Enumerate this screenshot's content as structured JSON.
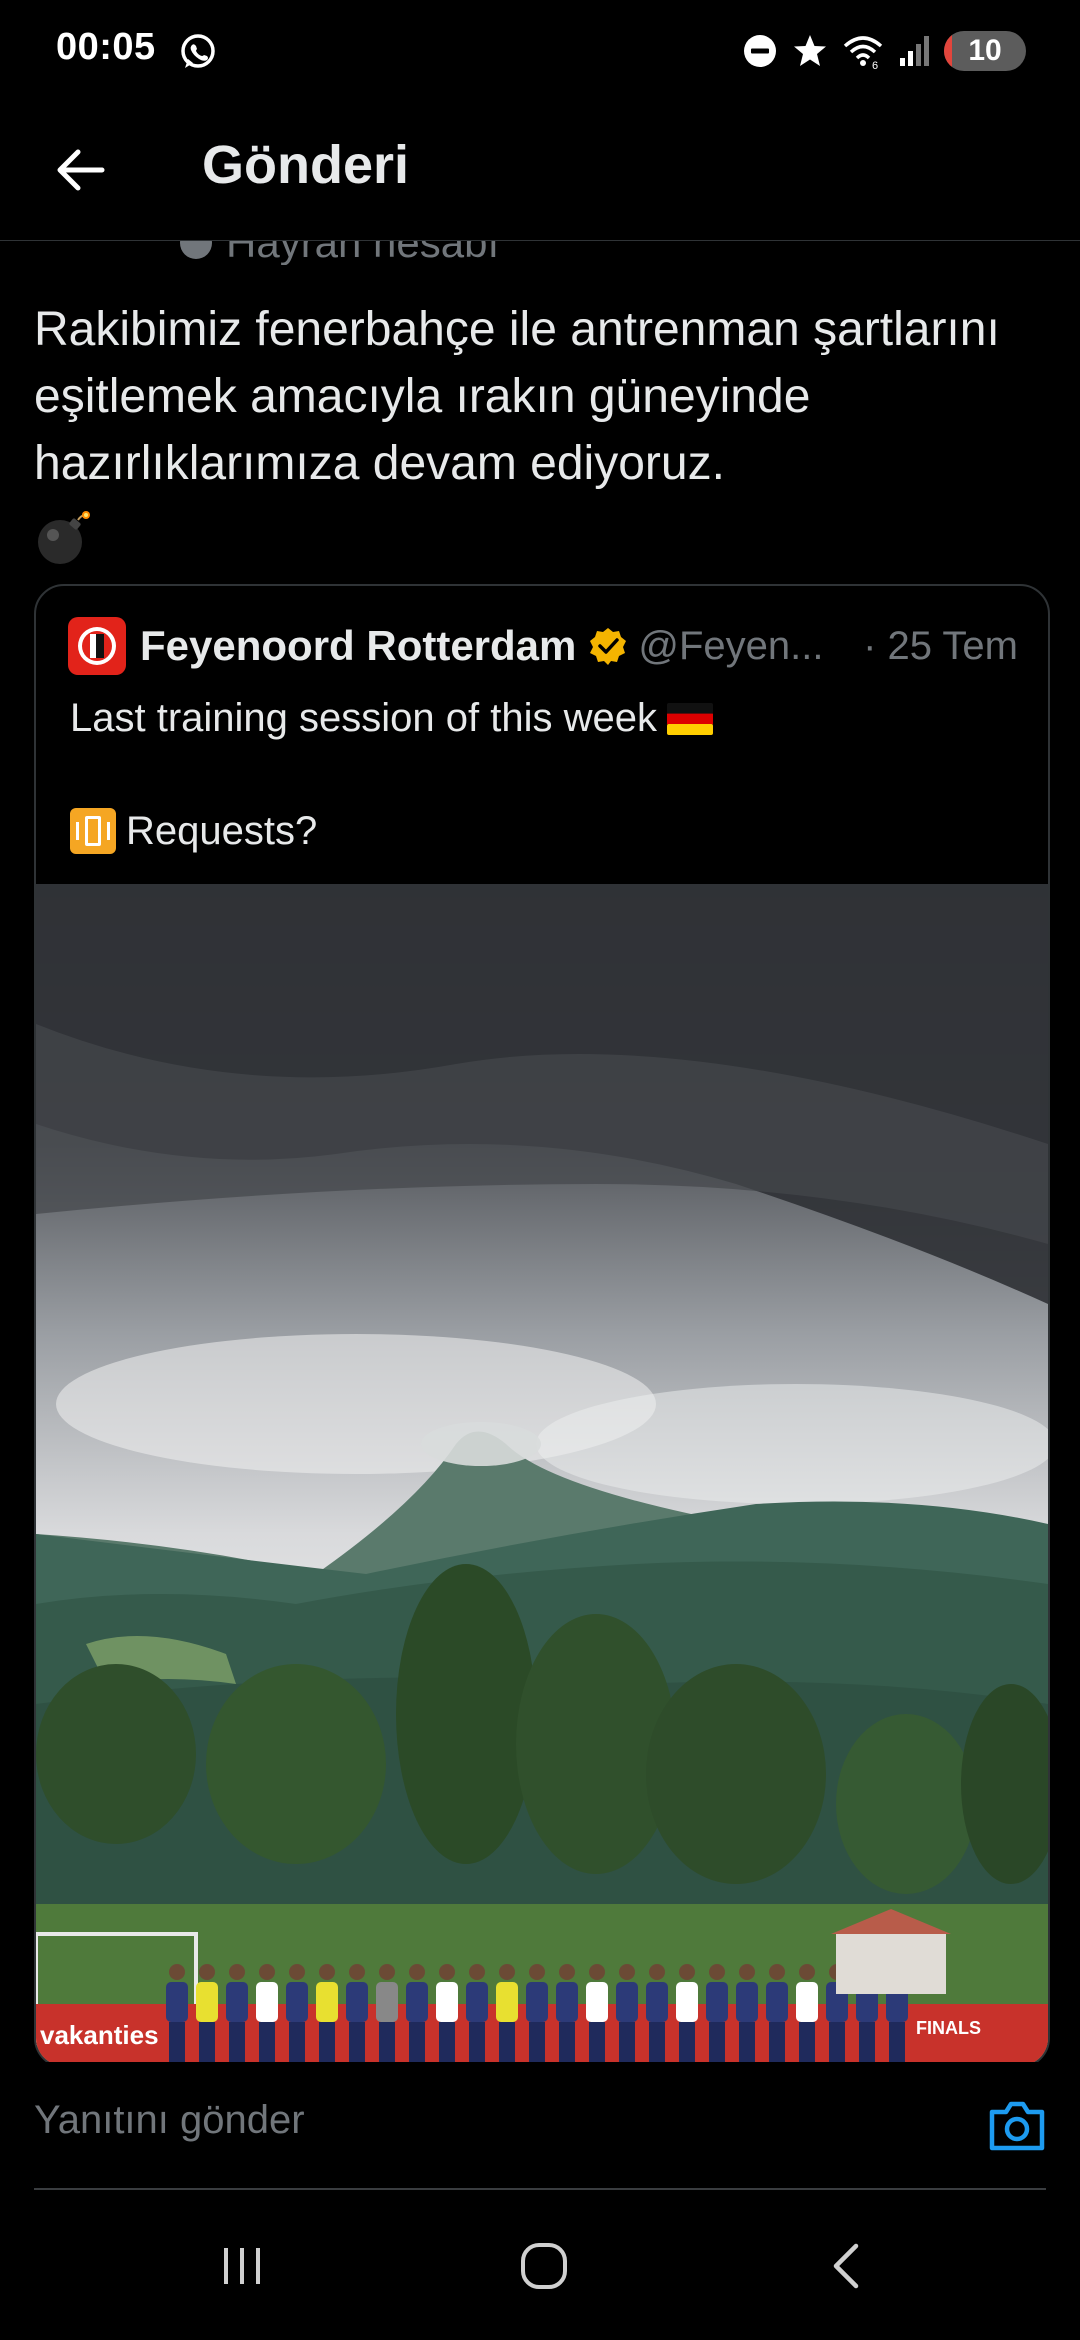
{
  "status_bar": {
    "time": "00:05",
    "battery": "10",
    "battery_level": 0.1,
    "icons": [
      "whatsapp-icon",
      "do-not-disturb-icon",
      "star-icon",
      "wifi-icon",
      "signal-icon"
    ]
  },
  "header": {
    "title": "Gönderi"
  },
  "author": {
    "partial_label": "Hayran hesabı"
  },
  "tweet": {
    "text": "Rakibimiz fenerbahçe ile antrenman şartlarını eşitlemek amacıyla ırakın güneyinde hazırlıklarımıza devam ediyoruz.",
    "emoji": "bomb-emoji"
  },
  "quote": {
    "name": "Feyenoord Rotterdam",
    "handle": "@Feyen...",
    "date": "· 25 Tem",
    "line1": "Last training session of this week",
    "line1_emoji": "german-flag",
    "line2": "Requests?",
    "line2_emoji": "vibration-mode-icon",
    "image_text": "vakanties",
    "image_text_right": "FINALS"
  },
  "reply": {
    "placeholder": "Yanıtını gönder"
  },
  "colors": {
    "background": "#000000",
    "text": "#e7e9ea",
    "muted": "#71767b",
    "border": "#2f3336",
    "accent": "#1d9bf0",
    "verified": "#f4b400",
    "feyenoord_red": "#e2231a"
  }
}
